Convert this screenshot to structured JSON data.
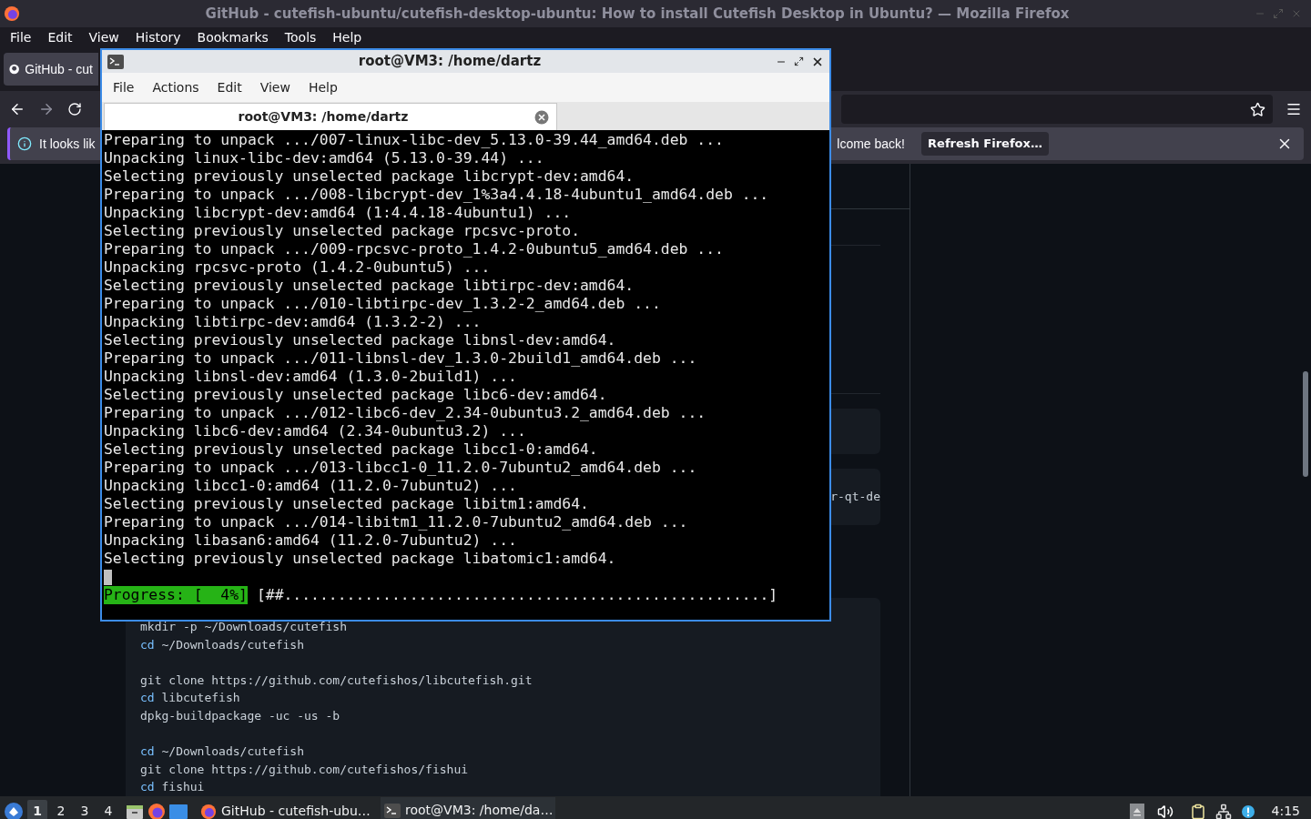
{
  "browser": {
    "title": "GitHub - cutefish-ubuntu/cutefish-desktop-ubuntu: How to install Cutefish Desktop in Ubuntu? — Mozilla Firefox",
    "menu": [
      "File",
      "Edit",
      "View",
      "History",
      "Bookmarks",
      "Tools",
      "Help"
    ],
    "tab": {
      "label": "GitHub - cut",
      "selected": true
    },
    "notification": {
      "start": "It looks lik",
      "end": "lcome back!",
      "button": "Refresh Firefox…"
    },
    "side_code": "r-qt-de",
    "code": [
      {
        "kind": "cmd",
        "cmd": "mkdir",
        "args": " -p ~/Downloads/cutefish",
        "builtin": false
      },
      {
        "kind": "cmd",
        "cmd": "cd",
        "args": " ~/Downloads/cutefish",
        "builtin": true
      },
      {
        "kind": "blank"
      },
      {
        "kind": "cmd",
        "cmd": "git",
        "args": " clone https://github.com/cutefishos/libcutefish.git",
        "builtin": false
      },
      {
        "kind": "cmd",
        "cmd": "cd",
        "args": " libcutefish",
        "builtin": true
      },
      {
        "kind": "cmd",
        "cmd": "dpkg-buildpackage",
        "args": " -uc -us -b",
        "builtin": false
      },
      {
        "kind": "blank"
      },
      {
        "kind": "cmd",
        "cmd": "cd",
        "args": " ~/Downloads/cutefish",
        "builtin": true
      },
      {
        "kind": "cmd",
        "cmd": "git",
        "args": " clone https://github.com/cutefishos/fishui",
        "builtin": false
      },
      {
        "kind": "cmd",
        "cmd": "cd",
        "args": " fishui",
        "builtin": true
      }
    ]
  },
  "terminal": {
    "title": "root@VM3: /home/dartz",
    "menu": [
      "File",
      "Actions",
      "Edit",
      "View",
      "Help"
    ],
    "tab": {
      "label": "root@VM3: /home/dartz",
      "selected": true
    },
    "lines": [
      "Preparing to unpack .../007-linux-libc-dev_5.13.0-39.44_amd64.deb ...",
      "Unpacking linux-libc-dev:amd64 (5.13.0-39.44) ...",
      "Selecting previously unselected package libcrypt-dev:amd64.",
      "Preparing to unpack .../008-libcrypt-dev_1%3a4.4.18-4ubuntu1_amd64.deb ...",
      "Unpacking libcrypt-dev:amd64 (1:4.4.18-4ubuntu1) ...",
      "Selecting previously unselected package rpcsvc-proto.",
      "Preparing to unpack .../009-rpcsvc-proto_1.4.2-0ubuntu5_amd64.deb ...",
      "Unpacking rpcsvc-proto (1.4.2-0ubuntu5) ...",
      "Selecting previously unselected package libtirpc-dev:amd64.",
      "Preparing to unpack .../010-libtirpc-dev_1.3.2-2_amd64.deb ...",
      "Unpacking libtirpc-dev:amd64 (1.3.2-2) ...",
      "Selecting previously unselected package libnsl-dev:amd64.",
      "Preparing to unpack .../011-libnsl-dev_1.3.0-2build1_amd64.deb ...",
      "Unpacking libnsl-dev:amd64 (1.3.0-2build1) ...",
      "Selecting previously unselected package libc6-dev:amd64.",
      "Preparing to unpack .../012-libc6-dev_2.34-0ubuntu3.2_amd64.deb ...",
      "Unpacking libc6-dev:amd64 (2.34-0ubuntu3.2) ...",
      "Selecting previously unselected package libcc1-0:amd64.",
      "Preparing to unpack .../013-libcc1-0_11.2.0-7ubuntu2_amd64.deb ...",
      "Unpacking libcc1-0:amd64 (11.2.0-7ubuntu2) ...",
      "Selecting previously unselected package libitm1:amd64.",
      "Preparing to unpack .../014-libitm1_11.2.0-7ubuntu2_amd64.deb ...",
      "Unpacking libasan6:amd64 (11.2.0-7ubuntu2) ...",
      "Selecting previously unselected package libatomic1:amd64."
    ],
    "progress_label": "Progress: [  4%]",
    "progress_bar": "[##......................................................]"
  },
  "taskbar": {
    "workspaces": [
      {
        "label": "1",
        "selected": true
      },
      {
        "label": "2",
        "selected": false
      },
      {
        "label": "3",
        "selected": false
      },
      {
        "label": "4",
        "selected": false
      }
    ],
    "tasks": [
      {
        "kind": "firefox",
        "label": "GitHub - cutefish-ubu…",
        "selected": false
      },
      {
        "kind": "terminal",
        "label": "root@VM3: /home/da…",
        "selected": true
      }
    ],
    "clock": "4:15"
  }
}
